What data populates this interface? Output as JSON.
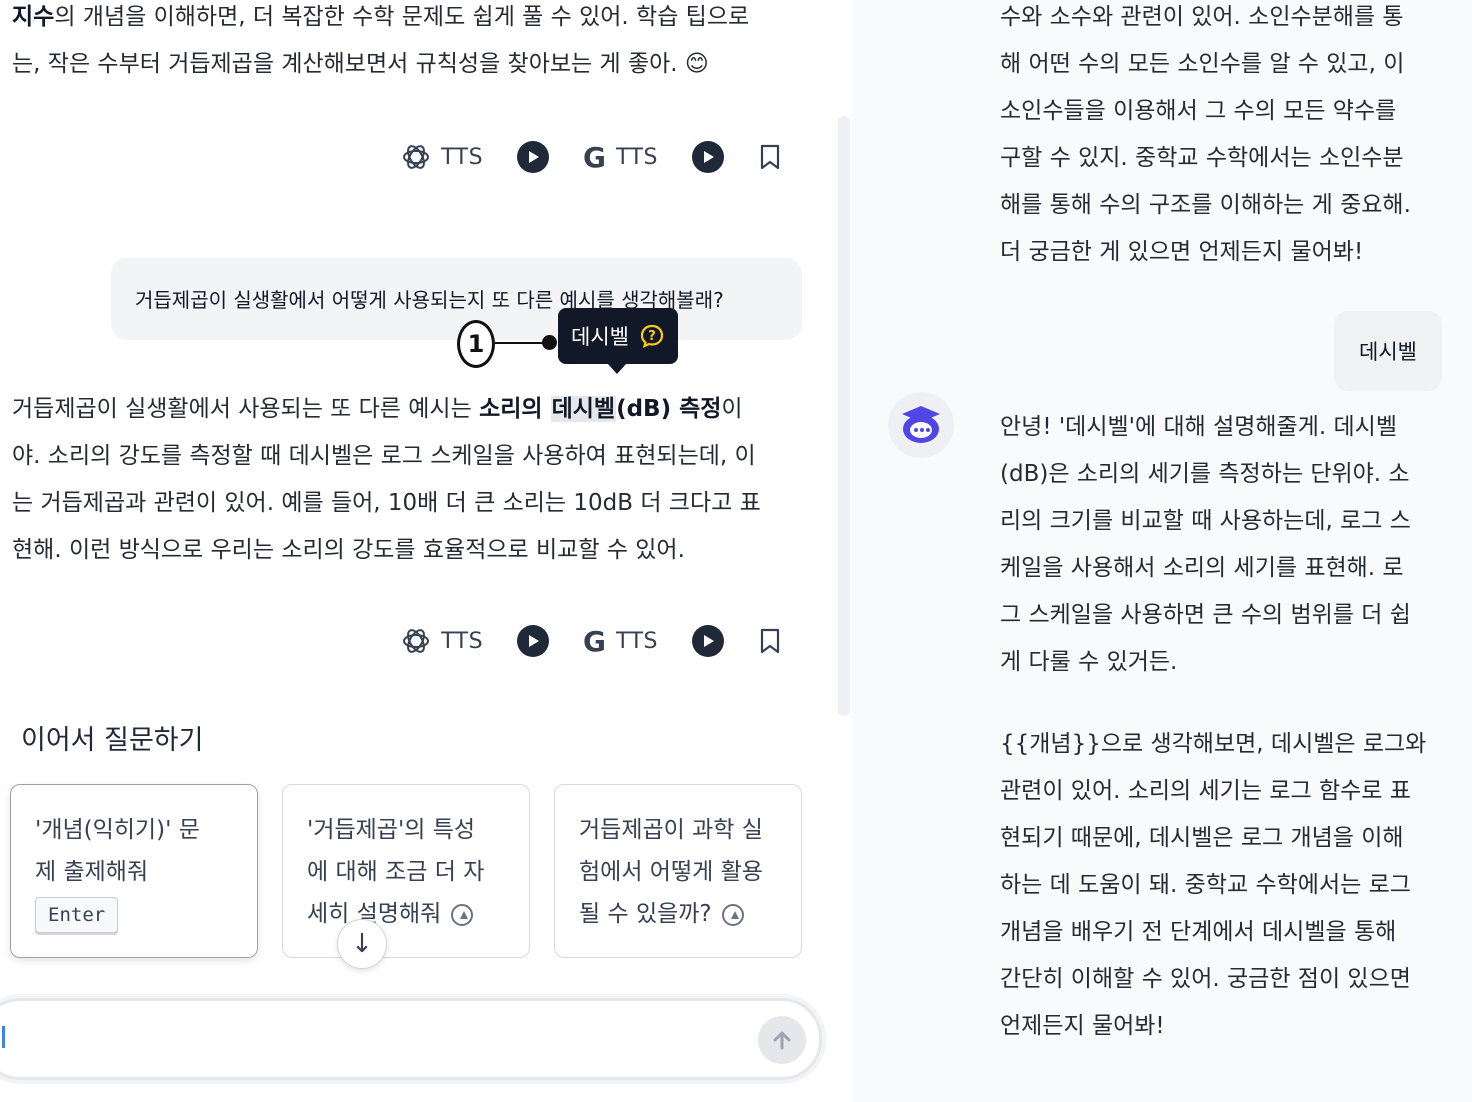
{
  "chat": {
    "para1_lead": "지수",
    "para1_rest_line1": "의 개념을 이해하면, 더 복잡한 수학 문제도 쉽게 풀 수 있어. 학습 팁으로",
    "para1_line2": "는, 작은 수부터 거듭제곱을 계산해보면서 규칙성을 찾아보는 게 좋아. 😊",
    "user_question": "거듭제곱이 실생활에서 어떻게 사용되는지 또 다른 예시를 생각해볼래?",
    "para2_a": "거듭제곱이 실생활에서 사용되는 또 다른 예시는 ",
    "para2_bold1": "소리의 ",
    "para2_highlight": "데시벨",
    "para2_bold2": "(dB) 측정",
    "para2_b": "이",
    "para2_line2": "야. 소리의 강도를 측정할 때 데시벨은 로그 스케일을 사용하여 표현되는데, 이",
    "para2_line3": "는 거듭제곱과 관련이 있어. 예를 들어, 10배 더 큰 소리는 10dB 더 크다고 표",
    "para2_line4": "현해. 이런 방식으로 우리는 소리의 강도를 효율적으로 비교할 수 있어."
  },
  "actions": {
    "openai_tts": "TTS",
    "google_tts": "TTS",
    "google_g": "G"
  },
  "tooltip": {
    "term": "데시벨",
    "marker": "1"
  },
  "followup": {
    "title": "이어서 질문하기",
    "cards": [
      {
        "line1": "'개념(익히기)' 문",
        "line2": "제 출제해줘",
        "key": "Enter"
      },
      {
        "line1": "'거듭제곱'의 특성",
        "line2": "에 대해 조금 더 자",
        "line3": "세히 설명해줘"
      },
      {
        "line1": "거듭제곱이 과학 실",
        "line2": "험에서 어떻게 활용",
        "line3": "될 수 있을까?"
      }
    ]
  },
  "scroll_down_icon": "↓",
  "history": {
    "prev_answer": [
      "수와 소수와 관련이 있어. 소인수분해를 통",
      "해 어떤 수의 모든 소인수를 알 수 있고, 이",
      "소인수들을 이용해서 그 수의 모든 약수를",
      "구할 수 있지. 중학교 수학에서는 소인수분",
      "해를 통해 수의 구조를 이해하는 게 중요해.",
      "더 궁금한 게 있으면 언제든지 물어봐!"
    ],
    "user_msg": "데시벨",
    "bot_answer_1": [
      "안녕! '데시벨'에 대해 설명해줄게. 데시벨",
      "(dB)은 소리의 세기를 측정하는 단위야. 소",
      "리의 크기를 비교할 때 사용하는데, 로그 스",
      "케일을 사용해서 소리의 세기를 표현해. 로",
      "그 스케일을 사용하면 큰 수의 범위를 더 쉽",
      "게 다룰 수 있거든."
    ],
    "bot_answer_2": [
      "{{개념}}으로 생각해보면, 데시벨은 로그와",
      "관련이 있어. 소리의 세기는 로그 함수로 표",
      "현되기 때문에, 데시벨은 로그 개념을 이해",
      "하는 데 도움이 돼. 중학교 수학에서는 로그",
      "개념을 배우기 전 단계에서 데시벨을 통해",
      "간단히 이해할 수 있어. 궁금한 점이 있으면",
      "언제든지 물어봐!"
    ]
  },
  "colors": {
    "tooltip_bg": "#111827",
    "tooltip_icon": "#facc15",
    "avatar_accent": "#4f46e5"
  }
}
